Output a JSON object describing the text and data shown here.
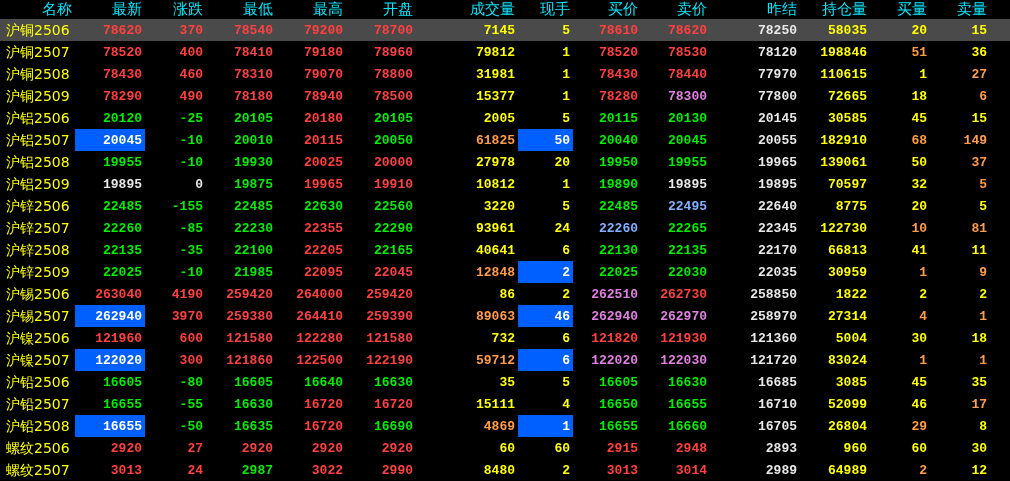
{
  "table": {
    "columns": [
      "名称",
      "最新",
      "涨跌",
      "最低",
      "最高",
      "开盘",
      "成交量",
      "现手",
      "买价",
      "卖价",
      "昨结",
      "持仓量",
      "买量",
      "卖量"
    ],
    "rows": [
      {
        "selected": true,
        "cells": [
          {
            "text": "沪铜2506",
            "color": "#ffff00",
            "highlighted": false
          },
          {
            "text": "78620",
            "color": "#ff4040",
            "highlighted": false
          },
          {
            "text": "370",
            "color": "#ff4040",
            "highlighted": false
          },
          {
            "text": "78540",
            "color": "#ff4040",
            "highlighted": false
          },
          {
            "text": "79200",
            "color": "#ff4040",
            "highlighted": false
          },
          {
            "text": "78700",
            "color": "#ff4040",
            "highlighted": false
          },
          {
            "text": "7145",
            "color": "#ffff00",
            "highlighted": false
          },
          {
            "text": "5",
            "color": "#ffff00",
            "highlighted": false
          },
          {
            "text": "78610",
            "color": "#ff4040",
            "highlighted": false
          },
          {
            "text": "78620",
            "color": "#ff4040",
            "highlighted": false
          },
          {
            "text": "78250",
            "color": "#e8e8e8",
            "highlighted": false
          },
          {
            "text": "58035",
            "color": "#ffff00",
            "highlighted": false
          },
          {
            "text": "20",
            "color": "#ffff00",
            "highlighted": false
          },
          {
            "text": "15",
            "color": "#ffff00",
            "highlighted": false
          }
        ]
      },
      {
        "selected": false,
        "cells": [
          {
            "text": "沪铜2507",
            "color": "#ffff00",
            "highlighted": false
          },
          {
            "text": "78520",
            "color": "#ff4040",
            "highlighted": false
          },
          {
            "text": "400",
            "color": "#ff4040",
            "highlighted": false
          },
          {
            "text": "78410",
            "color": "#ff4040",
            "highlighted": false
          },
          {
            "text": "79180",
            "color": "#ff4040",
            "highlighted": false
          },
          {
            "text": "78960",
            "color": "#ff4040",
            "highlighted": false
          },
          {
            "text": "79812",
            "color": "#ffff00",
            "highlighted": false
          },
          {
            "text": "1",
            "color": "#ffff00",
            "highlighted": false
          },
          {
            "text": "78520",
            "color": "#ff4040",
            "highlighted": false
          },
          {
            "text": "78530",
            "color": "#ff4040",
            "highlighted": false
          },
          {
            "text": "78120",
            "color": "#e8e8e8",
            "highlighted": false
          },
          {
            "text": "198846",
            "color": "#ffff00",
            "highlighted": false
          },
          {
            "text": "51",
            "color": "#ff9c4a",
            "highlighted": false
          },
          {
            "text": "36",
            "color": "#ffff00",
            "highlighted": false
          }
        ]
      },
      {
        "selected": false,
        "cells": [
          {
            "text": "沪铜2508",
            "color": "#ffff00",
            "highlighted": false
          },
          {
            "text": "78430",
            "color": "#ff4040",
            "highlighted": false
          },
          {
            "text": "460",
            "color": "#ff4040",
            "highlighted": false
          },
          {
            "text": "78310",
            "color": "#ff4040",
            "highlighted": false
          },
          {
            "text": "79070",
            "color": "#ff4040",
            "highlighted": false
          },
          {
            "text": "78800",
            "color": "#ff4040",
            "highlighted": false
          },
          {
            "text": "31981",
            "color": "#ffff00",
            "highlighted": false
          },
          {
            "text": "1",
            "color": "#ffff00",
            "highlighted": false
          },
          {
            "text": "78430",
            "color": "#ff4040",
            "highlighted": false
          },
          {
            "text": "78440",
            "color": "#ff4040",
            "highlighted": false
          },
          {
            "text": "77970",
            "color": "#e8e8e8",
            "highlighted": false
          },
          {
            "text": "110615",
            "color": "#ffff00",
            "highlighted": false
          },
          {
            "text": "1",
            "color": "#ffff00",
            "highlighted": false
          },
          {
            "text": "27",
            "color": "#ff9c4a",
            "highlighted": false
          }
        ]
      },
      {
        "selected": false,
        "cells": [
          {
            "text": "沪铜2509",
            "color": "#ffff00",
            "highlighted": false
          },
          {
            "text": "78290",
            "color": "#ff4040",
            "highlighted": false
          },
          {
            "text": "490",
            "color": "#ff4040",
            "highlighted": false
          },
          {
            "text": "78180",
            "color": "#ff4040",
            "highlighted": false
          },
          {
            "text": "78940",
            "color": "#ff4040",
            "highlighted": false
          },
          {
            "text": "78500",
            "color": "#ff4040",
            "highlighted": false
          },
          {
            "text": "15377",
            "color": "#ffff00",
            "highlighted": false
          },
          {
            "text": "1",
            "color": "#ffff00",
            "highlighted": false
          },
          {
            "text": "78280",
            "color": "#ff4040",
            "highlighted": false
          },
          {
            "text": "78300",
            "color": "#e080e0",
            "highlighted": false
          },
          {
            "text": "77800",
            "color": "#e8e8e8",
            "highlighted": false
          },
          {
            "text": "72665",
            "color": "#ffff00",
            "highlighted": false
          },
          {
            "text": "18",
            "color": "#ffff00",
            "highlighted": false
          },
          {
            "text": "6",
            "color": "#ff9c4a",
            "highlighted": false
          }
        ]
      },
      {
        "selected": false,
        "cells": [
          {
            "text": "沪铝2506",
            "color": "#ffff00",
            "highlighted": false
          },
          {
            "text": "20120",
            "color": "#00ee00",
            "highlighted": false
          },
          {
            "text": "-25",
            "color": "#00ee00",
            "highlighted": false
          },
          {
            "text": "20105",
            "color": "#00ee00",
            "highlighted": false
          },
          {
            "text": "20180",
            "color": "#ff4040",
            "highlighted": false
          },
          {
            "text": "20105",
            "color": "#00ee00",
            "highlighted": false
          },
          {
            "text": "2005",
            "color": "#ffff00",
            "highlighted": false
          },
          {
            "text": "5",
            "color": "#ffff00",
            "highlighted": false
          },
          {
            "text": "20115",
            "color": "#00ee00",
            "highlighted": false
          },
          {
            "text": "20130",
            "color": "#00ee00",
            "highlighted": false
          },
          {
            "text": "20145",
            "color": "#e8e8e8",
            "highlighted": false
          },
          {
            "text": "30585",
            "color": "#ffff00",
            "highlighted": false
          },
          {
            "text": "45",
            "color": "#ffff00",
            "highlighted": false
          },
          {
            "text": "15",
            "color": "#ffff00",
            "highlighted": false
          }
        ]
      },
      {
        "selected": false,
        "cells": [
          {
            "text": "沪铝2507",
            "color": "#ffff00",
            "highlighted": false
          },
          {
            "text": "20045",
            "color": "#ffffff",
            "highlighted": true
          },
          {
            "text": "-10",
            "color": "#00ee00",
            "highlighted": false
          },
          {
            "text": "20010",
            "color": "#00ee00",
            "highlighted": false
          },
          {
            "text": "20115",
            "color": "#ff4040",
            "highlighted": false
          },
          {
            "text": "20050",
            "color": "#00ee00",
            "highlighted": false
          },
          {
            "text": "61825",
            "color": "#ff9c4a",
            "highlighted": false
          },
          {
            "text": "50",
            "color": "#ffffff",
            "highlighted": true
          },
          {
            "text": "20040",
            "color": "#00ee00",
            "highlighted": false
          },
          {
            "text": "20045",
            "color": "#00ee00",
            "highlighted": false
          },
          {
            "text": "20055",
            "color": "#e8e8e8",
            "highlighted": false
          },
          {
            "text": "182910",
            "color": "#ffff00",
            "highlighted": false
          },
          {
            "text": "68",
            "color": "#ff9c4a",
            "highlighted": false
          },
          {
            "text": "149",
            "color": "#ff9c4a",
            "highlighted": false
          }
        ]
      },
      {
        "selected": false,
        "cells": [
          {
            "text": "沪铝2508",
            "color": "#ffff00",
            "highlighted": false
          },
          {
            "text": "19955",
            "color": "#00ee00",
            "highlighted": false
          },
          {
            "text": "-10",
            "color": "#00ee00",
            "highlighted": false
          },
          {
            "text": "19930",
            "color": "#00ee00",
            "highlighted": false
          },
          {
            "text": "20025",
            "color": "#ff4040",
            "highlighted": false
          },
          {
            "text": "20000",
            "color": "#ff4040",
            "highlighted": false
          },
          {
            "text": "27978",
            "color": "#ffff00",
            "highlighted": false
          },
          {
            "text": "20",
            "color": "#ffff00",
            "highlighted": false
          },
          {
            "text": "19950",
            "color": "#00ee00",
            "highlighted": false
          },
          {
            "text": "19955",
            "color": "#00ee00",
            "highlighted": false
          },
          {
            "text": "19965",
            "color": "#e8e8e8",
            "highlighted": false
          },
          {
            "text": "139061",
            "color": "#ffff00",
            "highlighted": false
          },
          {
            "text": "50",
            "color": "#ffff00",
            "highlighted": false
          },
          {
            "text": "37",
            "color": "#ff9c4a",
            "highlighted": false
          }
        ]
      },
      {
        "selected": false,
        "cells": [
          {
            "text": "沪铝2509",
            "color": "#ffff00",
            "highlighted": false
          },
          {
            "text": "19895",
            "color": "#e8e8e8",
            "highlighted": false
          },
          {
            "text": "0",
            "color": "#e8e8e8",
            "highlighted": false
          },
          {
            "text": "19875",
            "color": "#00ee00",
            "highlighted": false
          },
          {
            "text": "19965",
            "color": "#ff4040",
            "highlighted": false
          },
          {
            "text": "19910",
            "color": "#ff4040",
            "highlighted": false
          },
          {
            "text": "10812",
            "color": "#ffff00",
            "highlighted": false
          },
          {
            "text": "1",
            "color": "#ffff00",
            "highlighted": false
          },
          {
            "text": "19890",
            "color": "#00ee00",
            "highlighted": false
          },
          {
            "text": "19895",
            "color": "#e8e8e8",
            "highlighted": false
          },
          {
            "text": "19895",
            "color": "#e8e8e8",
            "highlighted": false
          },
          {
            "text": "70597",
            "color": "#ffff00",
            "highlighted": false
          },
          {
            "text": "32",
            "color": "#ffff00",
            "highlighted": false
          },
          {
            "text": "5",
            "color": "#ff9c4a",
            "highlighted": false
          }
        ]
      },
      {
        "selected": false,
        "cells": [
          {
            "text": "沪锌2506",
            "color": "#ffff00",
            "highlighted": false
          },
          {
            "text": "22485",
            "color": "#00ee00",
            "highlighted": false
          },
          {
            "text": "-155",
            "color": "#00ee00",
            "highlighted": false
          },
          {
            "text": "22485",
            "color": "#00ee00",
            "highlighted": false
          },
          {
            "text": "22630",
            "color": "#00ee00",
            "highlighted": false
          },
          {
            "text": "22560",
            "color": "#00ee00",
            "highlighted": false
          },
          {
            "text": "3220",
            "color": "#ffff00",
            "highlighted": false
          },
          {
            "text": "5",
            "color": "#ffff00",
            "highlighted": false
          },
          {
            "text": "22485",
            "color": "#00ee00",
            "highlighted": false
          },
          {
            "text": "22495",
            "color": "#80b0ff",
            "highlighted": false
          },
          {
            "text": "22640",
            "color": "#e8e8e8",
            "highlighted": false
          },
          {
            "text": "8775",
            "color": "#ffff00",
            "highlighted": false
          },
          {
            "text": "20",
            "color": "#ffff00",
            "highlighted": false
          },
          {
            "text": "5",
            "color": "#ffff00",
            "highlighted": false
          }
        ]
      },
      {
        "selected": false,
        "cells": [
          {
            "text": "沪锌2507",
            "color": "#ffff00",
            "highlighted": false
          },
          {
            "text": "22260",
            "color": "#00ee00",
            "highlighted": false
          },
          {
            "text": "-85",
            "color": "#00ee00",
            "highlighted": false
          },
          {
            "text": "22230",
            "color": "#00ee00",
            "highlighted": false
          },
          {
            "text": "22355",
            "color": "#ff4040",
            "highlighted": false
          },
          {
            "text": "22290",
            "color": "#00ee00",
            "highlighted": false
          },
          {
            "text": "93961",
            "color": "#ffff00",
            "highlighted": false
          },
          {
            "text": "24",
            "color": "#ffff00",
            "highlighted": false
          },
          {
            "text": "22260",
            "color": "#80b0ff",
            "highlighted": false
          },
          {
            "text": "22265",
            "color": "#00ee00",
            "highlighted": false
          },
          {
            "text": "22345",
            "color": "#e8e8e8",
            "highlighted": false
          },
          {
            "text": "122730",
            "color": "#ffff00",
            "highlighted": false
          },
          {
            "text": "10",
            "color": "#ff9c4a",
            "highlighted": false
          },
          {
            "text": "81",
            "color": "#ff9c4a",
            "highlighted": false
          }
        ]
      },
      {
        "selected": false,
        "cells": [
          {
            "text": "沪锌2508",
            "color": "#ffff00",
            "highlighted": false
          },
          {
            "text": "22135",
            "color": "#00ee00",
            "highlighted": false
          },
          {
            "text": "-35",
            "color": "#00ee00",
            "highlighted": false
          },
          {
            "text": "22100",
            "color": "#00ee00",
            "highlighted": false
          },
          {
            "text": "22205",
            "color": "#ff4040",
            "highlighted": false
          },
          {
            "text": "22165",
            "color": "#00ee00",
            "highlighted": false
          },
          {
            "text": "40641",
            "color": "#ffff00",
            "highlighted": false
          },
          {
            "text": "6",
            "color": "#ffff00",
            "highlighted": false
          },
          {
            "text": "22130",
            "color": "#00ee00",
            "highlighted": false
          },
          {
            "text": "22135",
            "color": "#00ee00",
            "highlighted": false
          },
          {
            "text": "22170",
            "color": "#e8e8e8",
            "highlighted": false
          },
          {
            "text": "66813",
            "color": "#ffff00",
            "highlighted": false
          },
          {
            "text": "41",
            "color": "#ffff00",
            "highlighted": false
          },
          {
            "text": "11",
            "color": "#ffff00",
            "highlighted": false
          }
        ]
      },
      {
        "selected": false,
        "cells": [
          {
            "text": "沪锌2509",
            "color": "#ffff00",
            "highlighted": false
          },
          {
            "text": "22025",
            "color": "#00ee00",
            "highlighted": false
          },
          {
            "text": "-10",
            "color": "#00ee00",
            "highlighted": false
          },
          {
            "text": "21985",
            "color": "#00ee00",
            "highlighted": false
          },
          {
            "text": "22095",
            "color": "#ff4040",
            "highlighted": false
          },
          {
            "text": "22045",
            "color": "#ff4040",
            "highlighted": false
          },
          {
            "text": "12848",
            "color": "#ff9c4a",
            "highlighted": false
          },
          {
            "text": "2",
            "color": "#ffffff",
            "highlighted": true
          },
          {
            "text": "22025",
            "color": "#00ee00",
            "highlighted": false
          },
          {
            "text": "22030",
            "color": "#00ee00",
            "highlighted": false
          },
          {
            "text": "22035",
            "color": "#e8e8e8",
            "highlighted": false
          },
          {
            "text": "30959",
            "color": "#ffff00",
            "highlighted": false
          },
          {
            "text": "1",
            "color": "#ff9c4a",
            "highlighted": false
          },
          {
            "text": "9",
            "color": "#ff9c4a",
            "highlighted": false
          }
        ]
      },
      {
        "selected": false,
        "cells": [
          {
            "text": "沪锡2506",
            "color": "#ffff00",
            "highlighted": false
          },
          {
            "text": "263040",
            "color": "#ff4040",
            "highlighted": false
          },
          {
            "text": "4190",
            "color": "#ff4040",
            "highlighted": false
          },
          {
            "text": "259420",
            "color": "#ff4040",
            "highlighted": false
          },
          {
            "text": "264000",
            "color": "#ff4040",
            "highlighted": false
          },
          {
            "text": "259420",
            "color": "#ff4040",
            "highlighted": false
          },
          {
            "text": "86",
            "color": "#ffff00",
            "highlighted": false
          },
          {
            "text": "2",
            "color": "#ffff00",
            "highlighted": false
          },
          {
            "text": "262510",
            "color": "#e080e0",
            "highlighted": false
          },
          {
            "text": "262730",
            "color": "#ff4040",
            "highlighted": false
          },
          {
            "text": "258850",
            "color": "#e8e8e8",
            "highlighted": false
          },
          {
            "text": "1822",
            "color": "#ffff00",
            "highlighted": false
          },
          {
            "text": "2",
            "color": "#ffff00",
            "highlighted": false
          },
          {
            "text": "2",
            "color": "#ffff00",
            "highlighted": false
          }
        ]
      },
      {
        "selected": false,
        "cells": [
          {
            "text": "沪锡2507",
            "color": "#ffff00",
            "highlighted": false
          },
          {
            "text": "262940",
            "color": "#ffffff",
            "highlighted": true
          },
          {
            "text": "3970",
            "color": "#ff4040",
            "highlighted": false
          },
          {
            "text": "259380",
            "color": "#ff4040",
            "highlighted": false
          },
          {
            "text": "264410",
            "color": "#ff4040",
            "highlighted": false
          },
          {
            "text": "259390",
            "color": "#ff4040",
            "highlighted": false
          },
          {
            "text": "89063",
            "color": "#ff9c4a",
            "highlighted": false
          },
          {
            "text": "46",
            "color": "#ffffff",
            "highlighted": true
          },
          {
            "text": "262940",
            "color": "#e080e0",
            "highlighted": false
          },
          {
            "text": "262970",
            "color": "#e080e0",
            "highlighted": false
          },
          {
            "text": "258970",
            "color": "#e8e8e8",
            "highlighted": false
          },
          {
            "text": "27314",
            "color": "#ffff00",
            "highlighted": false
          },
          {
            "text": "4",
            "color": "#ff9c4a",
            "highlighted": false
          },
          {
            "text": "1",
            "color": "#ff9c4a",
            "highlighted": false
          }
        ]
      },
      {
        "selected": false,
        "cells": [
          {
            "text": "沪镍2506",
            "color": "#ffff00",
            "highlighted": false
          },
          {
            "text": "121960",
            "color": "#ff4040",
            "highlighted": false
          },
          {
            "text": "600",
            "color": "#ff4040",
            "highlighted": false
          },
          {
            "text": "121580",
            "color": "#ff4040",
            "highlighted": false
          },
          {
            "text": "122280",
            "color": "#ff4040",
            "highlighted": false
          },
          {
            "text": "121580",
            "color": "#ff4040",
            "highlighted": false
          },
          {
            "text": "732",
            "color": "#ffff00",
            "highlighted": false
          },
          {
            "text": "6",
            "color": "#ffff00",
            "highlighted": false
          },
          {
            "text": "121820",
            "color": "#ff4040",
            "highlighted": false
          },
          {
            "text": "121930",
            "color": "#ff4040",
            "highlighted": false
          },
          {
            "text": "121360",
            "color": "#e8e8e8",
            "highlighted": false
          },
          {
            "text": "5004",
            "color": "#ffff00",
            "highlighted": false
          },
          {
            "text": "30",
            "color": "#ffff00",
            "highlighted": false
          },
          {
            "text": "18",
            "color": "#ffff00",
            "highlighted": false
          }
        ]
      },
      {
        "selected": false,
        "cells": [
          {
            "text": "沪镍2507",
            "color": "#ffff00",
            "highlighted": false
          },
          {
            "text": "122020",
            "color": "#ffffff",
            "highlighted": true
          },
          {
            "text": "300",
            "color": "#ff4040",
            "highlighted": false
          },
          {
            "text": "121860",
            "color": "#ff4040",
            "highlighted": false
          },
          {
            "text": "122500",
            "color": "#ff4040",
            "highlighted": false
          },
          {
            "text": "122190",
            "color": "#ff4040",
            "highlighted": false
          },
          {
            "text": "59712",
            "color": "#ff9c4a",
            "highlighted": false
          },
          {
            "text": "6",
            "color": "#ffffff",
            "highlighted": true
          },
          {
            "text": "122020",
            "color": "#e080e0",
            "highlighted": false
          },
          {
            "text": "122030",
            "color": "#e080e0",
            "highlighted": false
          },
          {
            "text": "121720",
            "color": "#e8e8e8",
            "highlighted": false
          },
          {
            "text": "83024",
            "color": "#ffff00",
            "highlighted": false
          },
          {
            "text": "1",
            "color": "#ff9c4a",
            "highlighted": false
          },
          {
            "text": "1",
            "color": "#ff9c4a",
            "highlighted": false
          }
        ]
      },
      {
        "selected": false,
        "cells": [
          {
            "text": "沪铅2506",
            "color": "#ffff00",
            "highlighted": false
          },
          {
            "text": "16605",
            "color": "#00ee00",
            "highlighted": false
          },
          {
            "text": "-80",
            "color": "#00ee00",
            "highlighted": false
          },
          {
            "text": "16605",
            "color": "#00ee00",
            "highlighted": false
          },
          {
            "text": "16640",
            "color": "#00ee00",
            "highlighted": false
          },
          {
            "text": "16630",
            "color": "#00ee00",
            "highlighted": false
          },
          {
            "text": "35",
            "color": "#ffff00",
            "highlighted": false
          },
          {
            "text": "5",
            "color": "#ffff00",
            "highlighted": false
          },
          {
            "text": "16605",
            "color": "#00ee00",
            "highlighted": false
          },
          {
            "text": "16630",
            "color": "#00ee00",
            "highlighted": false
          },
          {
            "text": "16685",
            "color": "#e8e8e8",
            "highlighted": false
          },
          {
            "text": "3085",
            "color": "#ffff00",
            "highlighted": false
          },
          {
            "text": "45",
            "color": "#ffff00",
            "highlighted": false
          },
          {
            "text": "35",
            "color": "#ffff00",
            "highlighted": false
          }
        ]
      },
      {
        "selected": false,
        "cells": [
          {
            "text": "沪铅2507",
            "color": "#ffff00",
            "highlighted": false
          },
          {
            "text": "16655",
            "color": "#00ee00",
            "highlighted": false
          },
          {
            "text": "-55",
            "color": "#00ee00",
            "highlighted": false
          },
          {
            "text": "16630",
            "color": "#00ee00",
            "highlighted": false
          },
          {
            "text": "16720",
            "color": "#ff4040",
            "highlighted": false
          },
          {
            "text": "16720",
            "color": "#ff4040",
            "highlighted": false
          },
          {
            "text": "15111",
            "color": "#ffff00",
            "highlighted": false
          },
          {
            "text": "4",
            "color": "#ffff00",
            "highlighted": false
          },
          {
            "text": "16650",
            "color": "#00ee00",
            "highlighted": false
          },
          {
            "text": "16655",
            "color": "#00ee00",
            "highlighted": false
          },
          {
            "text": "16710",
            "color": "#e8e8e8",
            "highlighted": false
          },
          {
            "text": "52099",
            "color": "#ffff00",
            "highlighted": false
          },
          {
            "text": "46",
            "color": "#ffff00",
            "highlighted": false
          },
          {
            "text": "17",
            "color": "#ff9c4a",
            "highlighted": false
          }
        ]
      },
      {
        "selected": false,
        "cells": [
          {
            "text": "沪铅2508",
            "color": "#ffff00",
            "highlighted": false
          },
          {
            "text": "16655",
            "color": "#ffffff",
            "highlighted": true
          },
          {
            "text": "-50",
            "color": "#00ee00",
            "highlighted": false
          },
          {
            "text": "16635",
            "color": "#00ee00",
            "highlighted": false
          },
          {
            "text": "16720",
            "color": "#ff4040",
            "highlighted": false
          },
          {
            "text": "16690",
            "color": "#00ee00",
            "highlighted": false
          },
          {
            "text": "4869",
            "color": "#ff9c4a",
            "highlighted": false
          },
          {
            "text": "1",
            "color": "#ffffff",
            "highlighted": true
          },
          {
            "text": "16655",
            "color": "#00ee00",
            "highlighted": false
          },
          {
            "text": "16660",
            "color": "#00ee00",
            "highlighted": false
          },
          {
            "text": "16705",
            "color": "#e8e8e8",
            "highlighted": false
          },
          {
            "text": "26804",
            "color": "#ffff00",
            "highlighted": false
          },
          {
            "text": "29",
            "color": "#ff9c4a",
            "highlighted": false
          },
          {
            "text": "8",
            "color": "#ffff00",
            "highlighted": false
          }
        ]
      },
      {
        "selected": false,
        "cells": [
          {
            "text": "螺纹2506",
            "color": "#ffff00",
            "highlighted": false
          },
          {
            "text": "2920",
            "color": "#ff4040",
            "highlighted": false
          },
          {
            "text": "27",
            "color": "#ff4040",
            "highlighted": false
          },
          {
            "text": "2920",
            "color": "#ff4040",
            "highlighted": false
          },
          {
            "text": "2920",
            "color": "#ff4040",
            "highlighted": false
          },
          {
            "text": "2920",
            "color": "#ff4040",
            "highlighted": false
          },
          {
            "text": "60",
            "color": "#ffff00",
            "highlighted": false
          },
          {
            "text": "60",
            "color": "#ffff00",
            "highlighted": false
          },
          {
            "text": "2915",
            "color": "#ff4040",
            "highlighted": false
          },
          {
            "text": "2948",
            "color": "#ff4040",
            "highlighted": false
          },
          {
            "text": "2893",
            "color": "#e8e8e8",
            "highlighted": false
          },
          {
            "text": "960",
            "color": "#ffff00",
            "highlighted": false
          },
          {
            "text": "60",
            "color": "#ffff00",
            "highlighted": false
          },
          {
            "text": "30",
            "color": "#ffff00",
            "highlighted": false
          }
        ]
      },
      {
        "selected": false,
        "cells": [
          {
            "text": "螺纹2507",
            "color": "#ffff00",
            "highlighted": false
          },
          {
            "text": "3013",
            "color": "#ff4040",
            "highlighted": false
          },
          {
            "text": "24",
            "color": "#ff4040",
            "highlighted": false
          },
          {
            "text": "2987",
            "color": "#00ee00",
            "highlighted": false
          },
          {
            "text": "3022",
            "color": "#ff4040",
            "highlighted": false
          },
          {
            "text": "2990",
            "color": "#ff4040",
            "highlighted": false
          },
          {
            "text": "8480",
            "color": "#ffff00",
            "highlighted": false
          },
          {
            "text": "2",
            "color": "#ffff00",
            "highlighted": false
          },
          {
            "text": "3013",
            "color": "#ff4040",
            "highlighted": false
          },
          {
            "text": "3014",
            "color": "#ff4040",
            "highlighted": false
          },
          {
            "text": "2989",
            "color": "#e8e8e8",
            "highlighted": false
          },
          {
            "text": "64989",
            "color": "#ffff00",
            "highlighted": false
          },
          {
            "text": "2",
            "color": "#ff9c4a",
            "highlighted": false
          },
          {
            "text": "12",
            "color": "#ffff00",
            "highlighted": false
          }
        ]
      }
    ]
  }
}
